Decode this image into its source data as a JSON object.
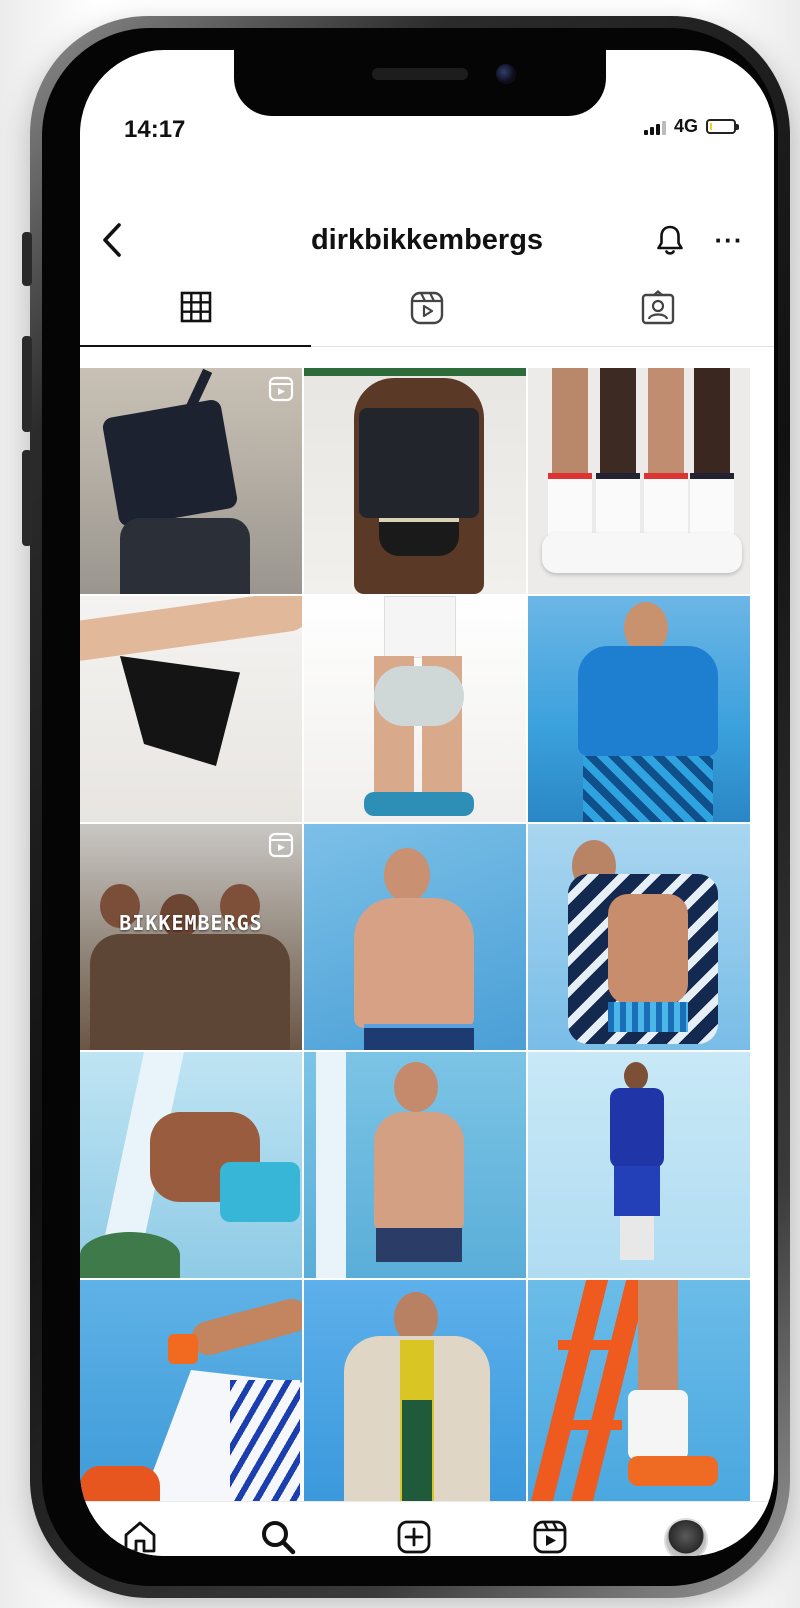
{
  "status_bar": {
    "time": "14:17",
    "network": "4G",
    "battery_color": "#f2d21a"
  },
  "header": {
    "username": "dirkbikkembergs",
    "back_icon": "back-arrow-icon",
    "bell_icon": "bell-icon",
    "more_icon": "more-icon",
    "more_label": "···"
  },
  "profile_tabs": [
    {
      "name": "grid",
      "icon": "grid-icon",
      "active": true
    },
    {
      "name": "reels",
      "icon": "reels-icon",
      "active": false
    },
    {
      "name": "tagged",
      "icon": "tagged-icon",
      "active": false
    }
  ],
  "posts": [
    {
      "scene": "model holding black crossbody bag",
      "is_reel": true
    },
    {
      "scene": "model wearing black utility vest and swim brief",
      "is_reel": false
    },
    {
      "scene": "legs with white socks and sneakers",
      "is_reel": false
    },
    {
      "scene": "hands holding black tote bag",
      "is_reel": false
    },
    {
      "scene": "model holding sneakers",
      "is_reel": false
    },
    {
      "scene": "model in blue shirt and patterned shorts",
      "is_reel": false
    },
    {
      "scene": "group of models",
      "is_reel": true,
      "overlay_text": "BIKKEMBERGS"
    },
    {
      "scene": "shirtless model by blue wall",
      "is_reel": false
    },
    {
      "scene": "model with towel and swim brief",
      "is_reel": false
    },
    {
      "scene": "model in turquoise swim shorts",
      "is_reel": false
    },
    {
      "scene": "model holding shower head",
      "is_reel": false
    },
    {
      "scene": "model in blue suit",
      "is_reel": false
    },
    {
      "scene": "arm with orange watch and track jacket",
      "is_reel": false
    },
    {
      "scene": "model in beige coat",
      "is_reel": false
    },
    {
      "scene": "legs on orange ladder",
      "is_reel": false
    }
  ],
  "bottom_nav": [
    {
      "name": "home",
      "icon": "home-icon"
    },
    {
      "name": "search",
      "icon": "search-icon"
    },
    {
      "name": "new-post",
      "icon": "plus-square-icon"
    },
    {
      "name": "reels",
      "icon": "reels-icon"
    },
    {
      "name": "profile",
      "icon": "avatar"
    }
  ],
  "colors": {
    "accent_dot": "#e0245e",
    "text": "#111111",
    "divider": "#e1e1e1"
  }
}
